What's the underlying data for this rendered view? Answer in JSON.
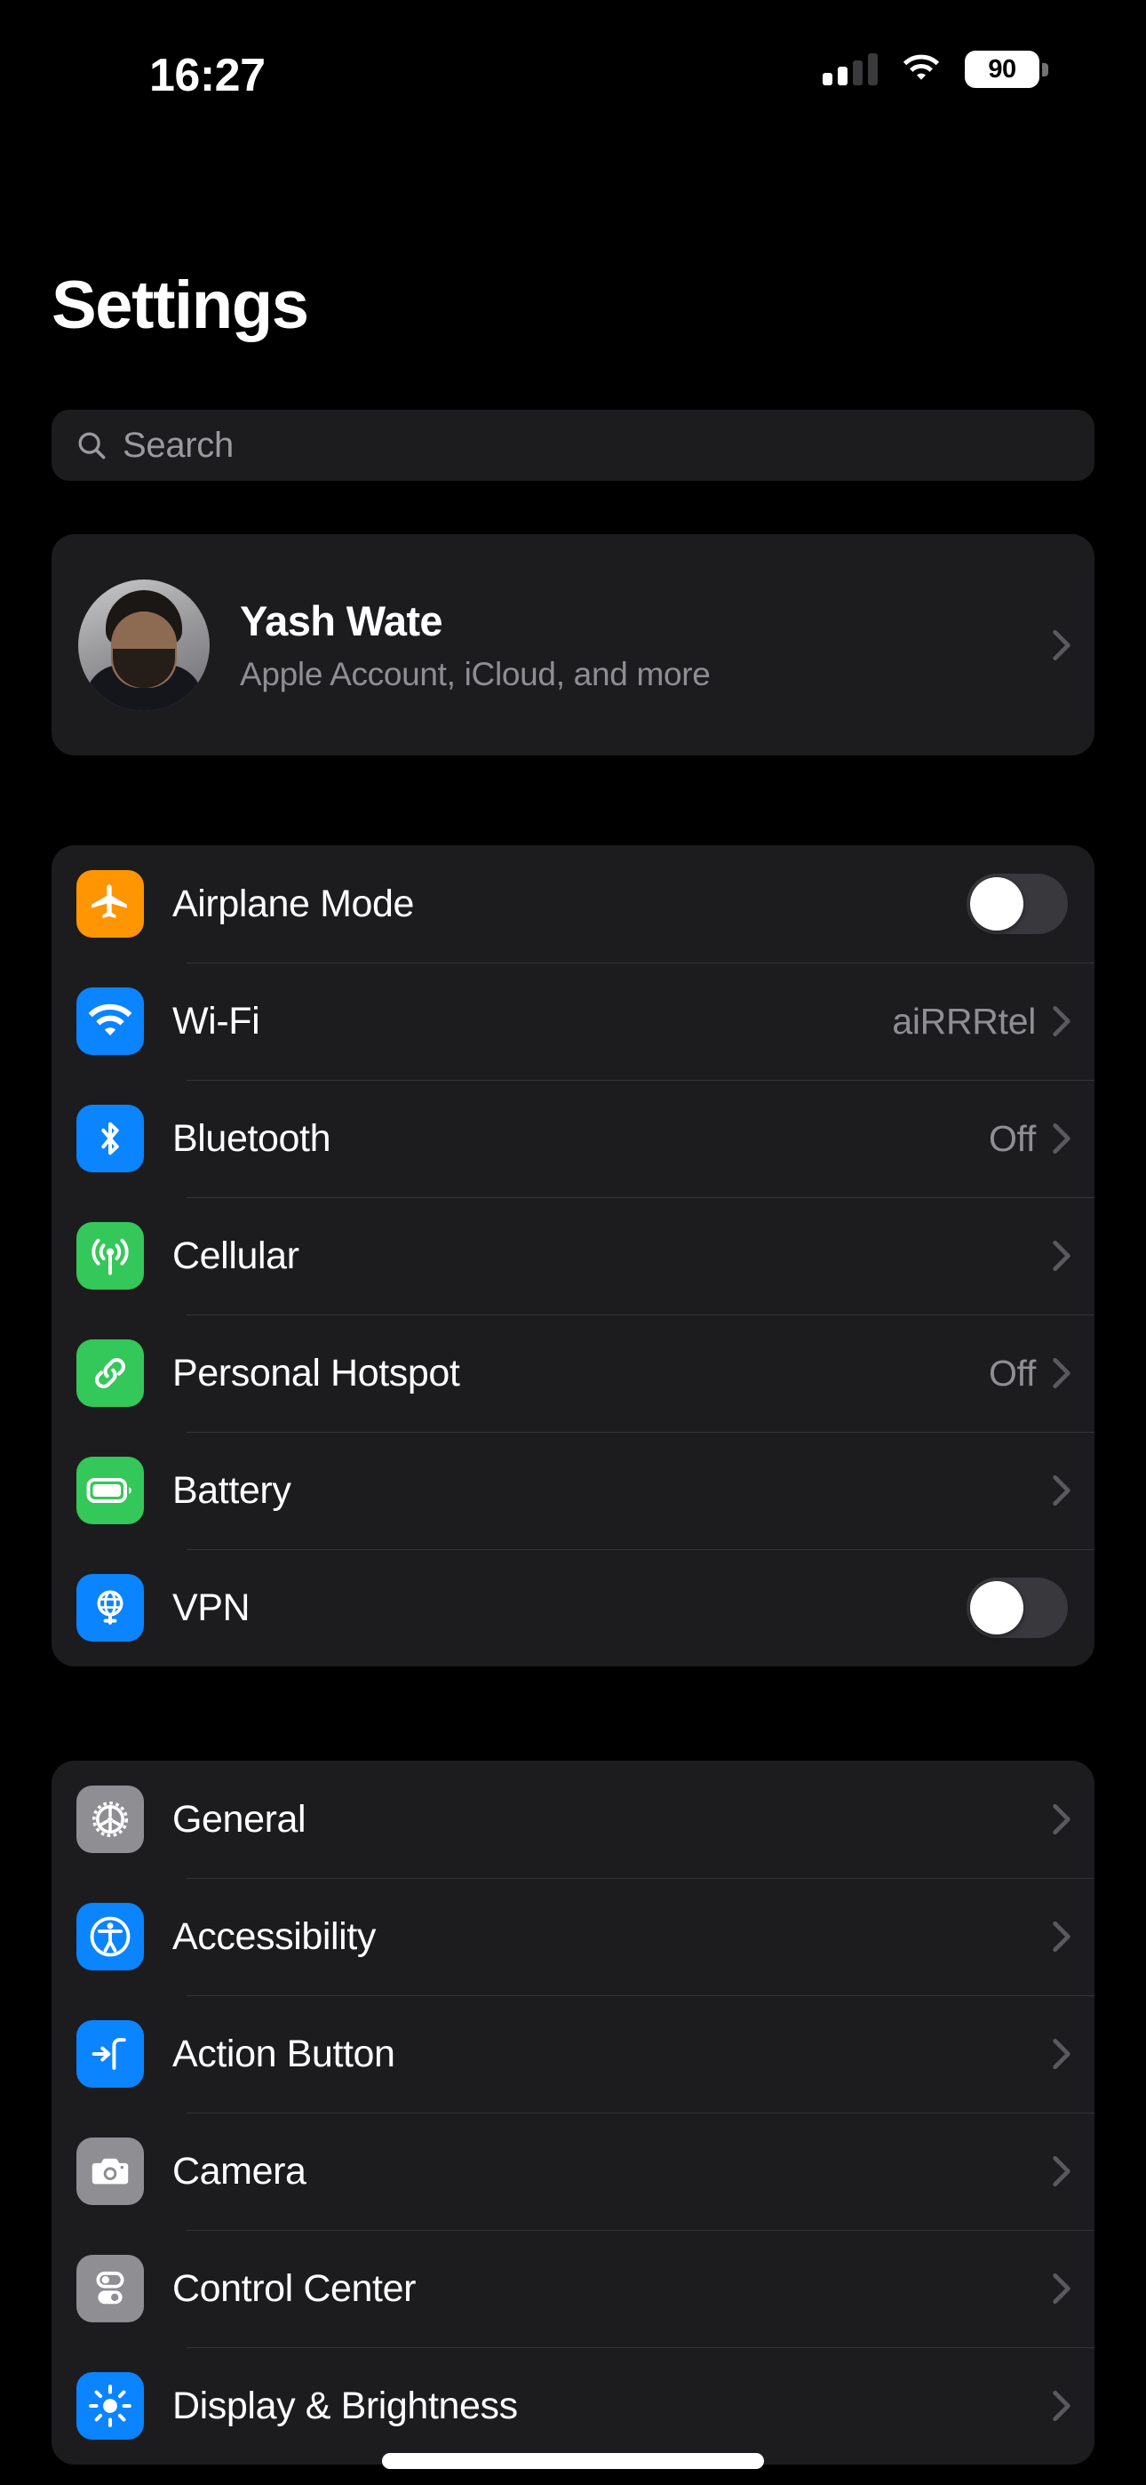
{
  "status_bar": {
    "time": "16:27",
    "battery_level": "90",
    "signal_bars_filled": 2,
    "signal_bars_total": 4,
    "wifi_icon": "wifi-icon",
    "battery_icon": "battery-icon"
  },
  "header": {
    "title": "Settings"
  },
  "search": {
    "placeholder": "Search",
    "icon": "search-icon"
  },
  "profile": {
    "name": "Yash Wate",
    "subtitle": "Apple Account, iCloud, and more",
    "avatar_alt": "avatar",
    "chevron": "chevron-right-icon"
  },
  "colors": {
    "background": "#000000",
    "card": "#1C1C1E",
    "separator": "#333336",
    "label": "#FFFFFF",
    "secondary_label": "#8E8E93",
    "blue": "#0A84FF",
    "green": "#34C759",
    "orange": "#FF9500",
    "gray": "#8E8E93",
    "toggle_off_track": "#39393D",
    "toggle_knob": "#FFFFFF"
  },
  "groups": [
    {
      "id": "connectivity",
      "rows": [
        {
          "label": "Airplane Mode",
          "icon": "airplane-icon",
          "icon_color": "#FF9500",
          "accessory": "toggle",
          "toggle_on": false
        },
        {
          "label": "Wi-Fi",
          "icon": "wifi-icon",
          "icon_color": "#0A84FF",
          "accessory": "value",
          "value": "aiRRRtel"
        },
        {
          "label": "Bluetooth",
          "icon": "bluetooth-icon",
          "icon_color": "#0A84FF",
          "accessory": "value",
          "value": "Off"
        },
        {
          "label": "Cellular",
          "icon": "cellular-antenna-icon",
          "icon_color": "#34C759",
          "accessory": "value",
          "value": ""
        },
        {
          "label": "Personal Hotspot",
          "icon": "hotspot-link-icon",
          "icon_color": "#34C759",
          "accessory": "value",
          "value": "Off"
        },
        {
          "label": "Battery",
          "icon": "battery-icon",
          "icon_color": "#34C759",
          "accessory": "value",
          "value": ""
        },
        {
          "label": "VPN",
          "icon": "vpn-globe-icon",
          "icon_color": "#0A84FF",
          "accessory": "toggle",
          "toggle_on": false
        }
      ]
    },
    {
      "id": "system",
      "rows": [
        {
          "label": "General",
          "icon": "gear-icon",
          "icon_color": "#8E8E93",
          "accessory": "value",
          "value": ""
        },
        {
          "label": "Accessibility",
          "icon": "accessibility-icon",
          "icon_color": "#0A84FF",
          "accessory": "value",
          "value": ""
        },
        {
          "label": "Action Button",
          "icon": "action-button-icon",
          "icon_color": "#0A84FF",
          "accessory": "value",
          "value": ""
        },
        {
          "label": "Camera",
          "icon": "camera-icon",
          "icon_color": "#8E8E93",
          "accessory": "value",
          "value": ""
        },
        {
          "label": "Control Center",
          "icon": "control-center-icon",
          "icon_color": "#8E8E93",
          "accessory": "value",
          "value": ""
        },
        {
          "label": "Display & Brightness",
          "icon": "brightness-sun-icon",
          "icon_color": "#0A84FF",
          "accessory": "value",
          "value": ""
        }
      ]
    }
  ]
}
